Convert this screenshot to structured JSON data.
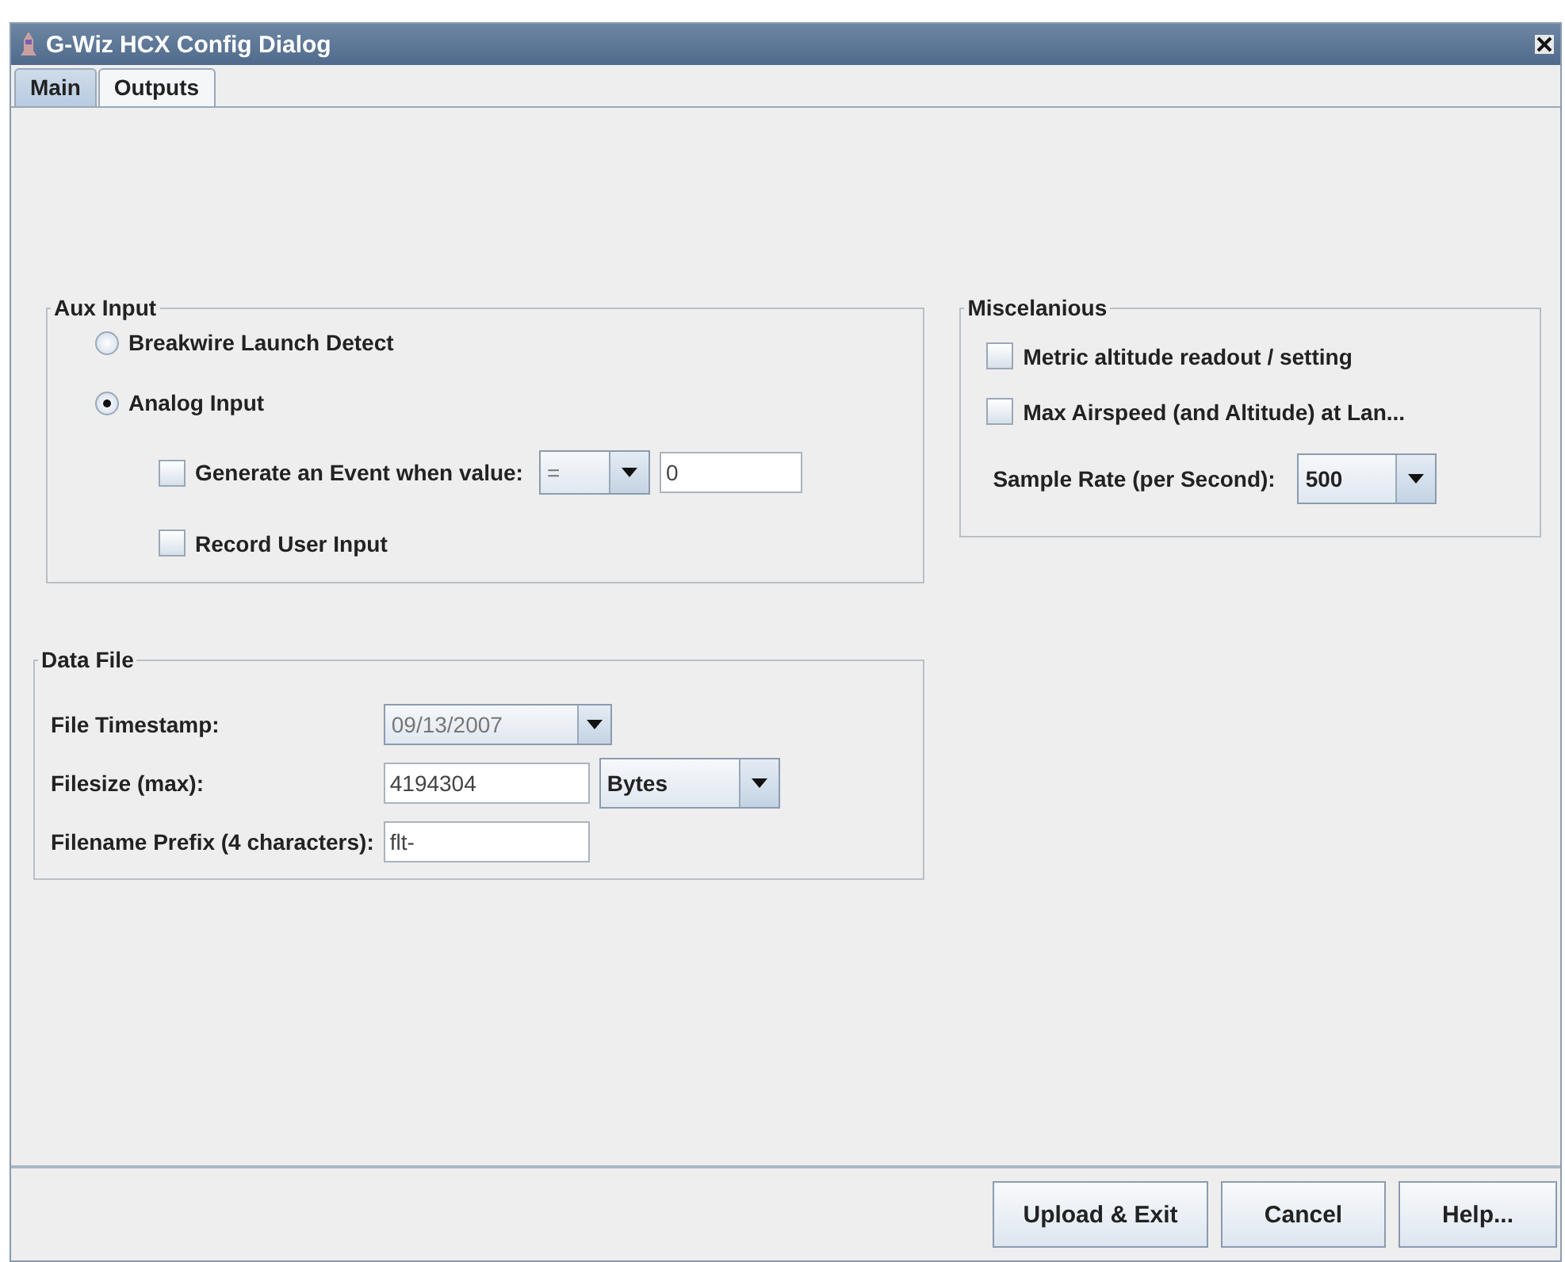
{
  "window": {
    "title": "G-Wiz HCX Config Dialog"
  },
  "tabs": [
    {
      "label": "Main",
      "selected": true
    },
    {
      "label": "Outputs",
      "selected": false
    }
  ],
  "aux_input": {
    "title": "Aux Input",
    "radios": [
      {
        "label": "Breakwire Launch Detect",
        "selected": false
      },
      {
        "label": "Analog Input",
        "selected": true
      }
    ],
    "event": {
      "label": "Generate an Event when value:",
      "checked": false,
      "operator": "=",
      "value": "0"
    },
    "record": {
      "label": "Record User Input",
      "checked": false
    }
  },
  "miscellaneous": {
    "title": "Miscelanious",
    "checks": [
      {
        "label": "Metric altitude readout / setting",
        "checked": false
      },
      {
        "label": "Max Airspeed (and Altitude) at Lan...",
        "checked": false
      }
    ],
    "sample_rate": {
      "label": "Sample Rate (per Second):",
      "value": "500"
    }
  },
  "data_file": {
    "title": "Data File",
    "timestamp": {
      "label": "File Timestamp:",
      "value": "09/13/2007"
    },
    "filesize": {
      "label": "Filesize (max):",
      "value": "4194304",
      "unit": "Bytes"
    },
    "prefix": {
      "label": "Filename Prefix (4 characters):",
      "value": "flt-"
    }
  },
  "buttons": [
    "Upload & Exit",
    "Cancel",
    "Help..."
  ]
}
